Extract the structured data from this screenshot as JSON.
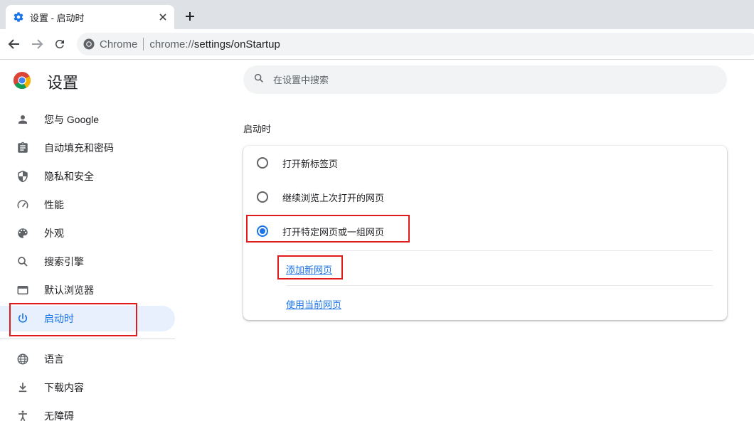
{
  "browser": {
    "tab_title": "设置 - 启动时",
    "omnibox_site": "Chrome",
    "url_prefix": "chrome://",
    "url_path": "settings/onStartup"
  },
  "sidebar": {
    "title": "设置",
    "items": [
      {
        "label": "您与 Google",
        "icon": "person-icon"
      },
      {
        "label": "自动填充和密码",
        "icon": "clipboard-icon"
      },
      {
        "label": "隐私和安全",
        "icon": "shield-icon"
      },
      {
        "label": "性能",
        "icon": "speedometer-icon"
      },
      {
        "label": "外观",
        "icon": "palette-icon"
      },
      {
        "label": "搜索引擎",
        "icon": "search-icon"
      },
      {
        "label": "默认浏览器",
        "icon": "browser-window-icon"
      },
      {
        "label": "启动时",
        "icon": "power-icon",
        "active": true
      },
      {
        "label": "语言",
        "icon": "globe-icon"
      },
      {
        "label": "下载内容",
        "icon": "download-icon"
      },
      {
        "label": "无障碍",
        "icon": "accessibility-icon"
      }
    ]
  },
  "search": {
    "placeholder": "在设置中搜索"
  },
  "startup": {
    "section_title": "启动时",
    "options": [
      {
        "label": "打开新标签页",
        "selected": false
      },
      {
        "label": "继续浏览上次打开的网页",
        "selected": false
      },
      {
        "label": "打开特定网页或一组网页",
        "selected": true
      }
    ],
    "add_page_link": "添加新网页",
    "use_current_link": "使用当前网页"
  },
  "colors": {
    "accent": "#1a73e8",
    "highlight": "#e01b1b",
    "active_bg": "#e8f0fe"
  }
}
